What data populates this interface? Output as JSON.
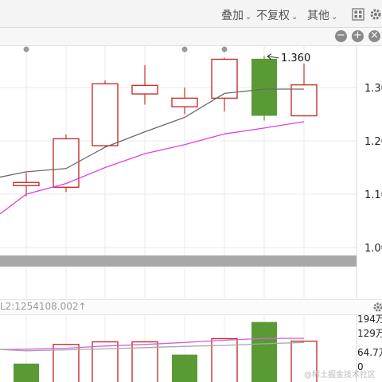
{
  "toolbar": {
    "overlay_label": "叠加",
    "adjust_label": "不复权",
    "other_label": "其他",
    "chevron_glyph": "⌄",
    "icons": [
      "grid-icon",
      "gear-icon"
    ]
  },
  "subbar": {
    "zoom_out_glyph": "−",
    "zoom_in_glyph": "+",
    "close_glyph": "×"
  },
  "volume_panel": {
    "info_text": "L2:1254108.002↑"
  },
  "colors": {
    "up": "#c8312f",
    "down": "#5a9a35",
    "ma_gray": "#6a6a6a",
    "ma_pink": "#e040e0",
    "vol_ma_pink": "#d860d8",
    "vol_ma_gray": "#a8a8a8",
    "band": "#a8a8a8"
  },
  "watermark": "@稀土掘金技术社区",
  "chart_data": [
    {
      "type": "candlestick",
      "title": "",
      "y_axis_labels": [
        "1.30",
        "1.20",
        "1.10",
        "1.00"
      ],
      "ylim": [
        0.97,
        1.43
      ],
      "high_marker_label": "1.360",
      "candles": [
        {
          "open": 1.116,
          "close": 1.122,
          "high": 1.14,
          "low": 1.096,
          "color": "up"
        },
        {
          "open": 1.113,
          "close": 1.204,
          "high": 1.212,
          "low": 1.104,
          "color": "up"
        },
        {
          "open": 1.191,
          "close": 1.307,
          "high": 1.313,
          "low": 1.191,
          "color": "up"
        },
        {
          "open": 1.288,
          "close": 1.304,
          "high": 1.342,
          "low": 1.268,
          "color": "up"
        },
        {
          "open": 1.264,
          "close": 1.28,
          "high": 1.3,
          "low": 1.25,
          "color": "up"
        },
        {
          "open": 1.28,
          "close": 1.353,
          "high": 1.356,
          "low": 1.255,
          "color": "up"
        },
        {
          "open": 1.354,
          "close": 1.247,
          "high": 1.36,
          "low": 1.238,
          "color": "down"
        },
        {
          "open": 1.247,
          "close": 1.305,
          "high": 1.345,
          "low": 1.247,
          "color": "up"
        }
      ],
      "ma_series": [
        {
          "name": "",
          "color_key": "ma_gray",
          "values": [
            1.132,
            1.142,
            1.148,
            1.188,
            1.217,
            1.244,
            1.289,
            1.297,
            1.297
          ]
        },
        {
          "name": "",
          "color_key": "ma_pink",
          "values": [
            1.063,
            1.1,
            1.12,
            1.15,
            1.176,
            1.193,
            1.213,
            1.224,
            1.236
          ]
        }
      ]
    },
    {
      "type": "bar",
      "title": "",
      "y_axis_labels": [
        "194万",
        "129万",
        "64.7万",
        "0"
      ],
      "ylim": [
        0,
        2000000
      ],
      "values": [
        600000,
        1200000,
        1280000,
        1280000,
        880000,
        1380000,
        1900000,
        1300000
      ],
      "bar_styles": [
        "down",
        "up",
        "up",
        "up",
        "down",
        "up",
        "down",
        "up"
      ],
      "ma_series": [
        {
          "name": "",
          "color_key": "vol_ma_pink",
          "values": [
            1040000,
            1050000,
            1080000,
            1150000,
            1200000,
            1260000,
            1330000,
            1390000,
            1390000
          ]
        },
        {
          "name": "",
          "color_key": "vol_ma_gray",
          "values": [
            1040000,
            1000000,
            1030000,
            1060000,
            1100000,
            1140000,
            1170000,
            1220000,
            1260000
          ]
        }
      ]
    }
  ]
}
